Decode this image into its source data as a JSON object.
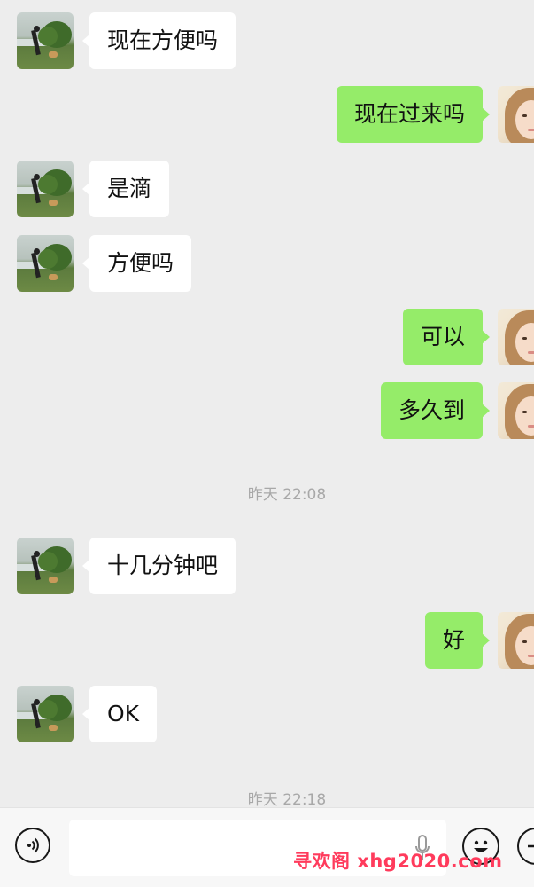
{
  "conversation": {
    "messages": [
      {
        "side": "left",
        "text": "现在方便吗"
      },
      {
        "side": "right",
        "text": "现在过来吗"
      },
      {
        "side": "left",
        "text": "是滴"
      },
      {
        "side": "left",
        "text": "方便吗"
      },
      {
        "side": "right",
        "text": "可以"
      },
      {
        "side": "right",
        "text": "多久到"
      },
      {
        "side": "left",
        "text": "十几分钟吧"
      },
      {
        "side": "right",
        "text": "好"
      },
      {
        "side": "left",
        "text": "OK"
      }
    ],
    "timestamps": [
      "昨天 22:08",
      "昨天 22:18"
    ]
  },
  "avatars": {
    "contact": "landscape-person-with-dog-photo",
    "self": "young-woman-portrait-photo"
  },
  "input_bar": {
    "voice_icon": "voice-input-icon",
    "mic_icon": "microphone-icon",
    "emoji_icon": "emoji-icon",
    "plus_icon": "plus-icon"
  },
  "watermark": "寻欢阁 xhg2020.com",
  "colors": {
    "background": "#ededed",
    "outgoing_bubble": "#95ec69",
    "incoming_bubble": "#ffffff",
    "timestamp_text": "#a8a8a8",
    "watermark": "#ff3b5c"
  }
}
